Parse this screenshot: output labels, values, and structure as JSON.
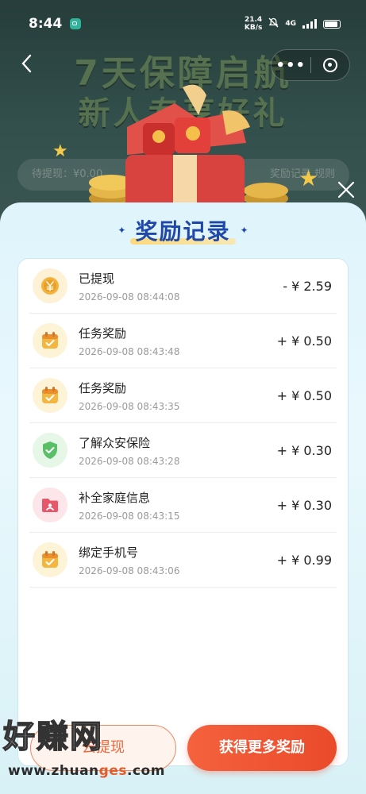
{
  "status_bar": {
    "time": "8:44",
    "net_speed_value": "21.4",
    "net_speed_unit": "KB/s",
    "network_type": "4G"
  },
  "background": {
    "banner_line1": "7天保障启航",
    "banner_line2": "新人专享好礼",
    "pending_text": "待提现：¥0.00",
    "rules_text": "奖励记录  规则"
  },
  "modal": {
    "title": "奖励记录",
    "records": [
      {
        "title": "已提现",
        "time": "2026-09-08 08:44:08",
        "amount": "- ¥ 2.59",
        "icon": "coin-icon",
        "icon_bg": "#fdf1d6"
      },
      {
        "title": "任务奖励",
        "time": "2026-09-08 08:43:48",
        "amount": "+ ¥ 0.50",
        "icon": "calendar-check-icon",
        "icon_bg": "#fdf4d8"
      },
      {
        "title": "任务奖励",
        "time": "2026-09-08 08:43:35",
        "amount": "+ ¥ 0.50",
        "icon": "calendar-check-icon",
        "icon_bg": "#fdf4d8"
      },
      {
        "title": "了解众安保险",
        "time": "2026-09-08 08:43:28",
        "amount": "+ ¥ 0.30",
        "icon": "shield-icon",
        "icon_bg": "#e6f7e7"
      },
      {
        "title": "补全家庭信息",
        "time": "2026-09-08 08:43:15",
        "amount": "+ ¥ 0.30",
        "icon": "folder-icon",
        "icon_bg": "#fde6ea"
      },
      {
        "title": "绑定手机号",
        "time": "2026-09-08 08:43:06",
        "amount": "+ ¥ 0.99",
        "icon": "calendar-check-icon",
        "icon_bg": "#fdf4d8"
      }
    ],
    "left_button_label": "去提现",
    "right_button_label": "获得更多奖励"
  },
  "watermark": {
    "brand": "好赚网",
    "url_prefix": "www.zhuan",
    "url_accent": "ges",
    "url_suffix": ".com"
  },
  "colors": {
    "accent_orange": "#ea4a2a",
    "title_blue": "#1f48a8"
  }
}
